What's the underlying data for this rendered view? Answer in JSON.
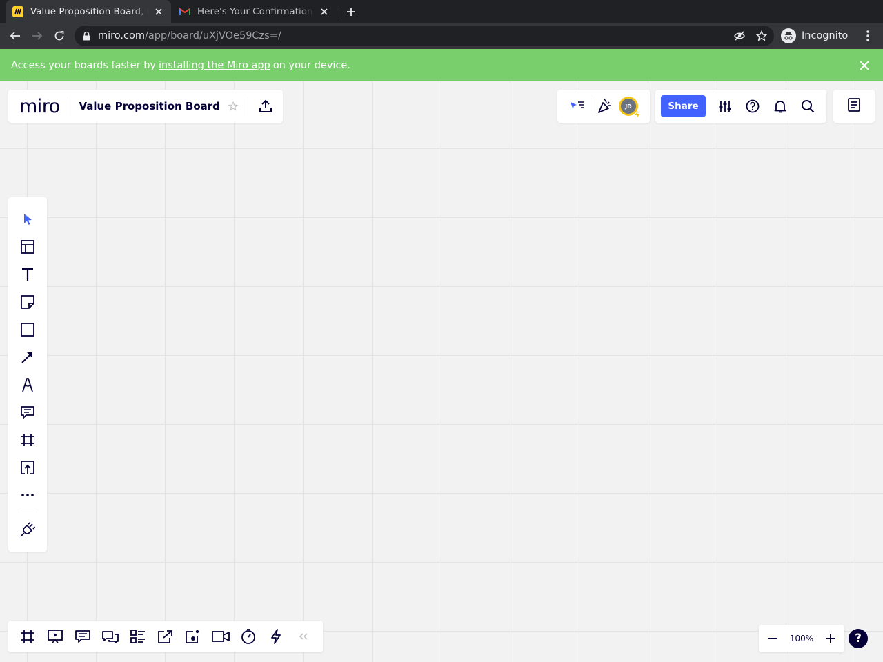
{
  "browser": {
    "tabs": [
      {
        "title": "Value Proposition Board, Online Whiteboard",
        "active": true,
        "favicon": "miro-favicon"
      },
      {
        "title": "Here's Your Confirmation Code",
        "active": false,
        "favicon": "gmail-favicon"
      }
    ],
    "url": {
      "domain": "miro.com",
      "path": "/app/board/uXjVOe59Czs=/"
    },
    "profile_label": "Incognito"
  },
  "banner": {
    "text_before": "Access your boards faster by",
    "link_text": "installing the Miro app",
    "text_after": "on your device.",
    "color": "#79cf6b"
  },
  "header": {
    "logo": "miro",
    "board_title": "Value Proposition Board",
    "share_label": "Share",
    "avatar_initials": "JD",
    "accent": "#4262ff"
  },
  "left_toolbar": {
    "tools": [
      "select-icon",
      "templates-icon",
      "text-icon",
      "sticky-note-icon",
      "shape-icon",
      "connection-line-icon",
      "pen-icon",
      "comment-icon",
      "frame-icon",
      "upload-icon",
      "more-tools-icon",
      "apps-plug-icon"
    ]
  },
  "bottom_toolbar": {
    "tools": [
      "frames-icon",
      "presentation-icon",
      "notes-icon",
      "chat-icon",
      "cards-icon",
      "share-screen-icon",
      "screen-record-icon",
      "video-call-icon",
      "timer-icon",
      "lightning-icon",
      "collapse-icon"
    ]
  },
  "zoom": {
    "level": "100%"
  },
  "help_label": "?"
}
